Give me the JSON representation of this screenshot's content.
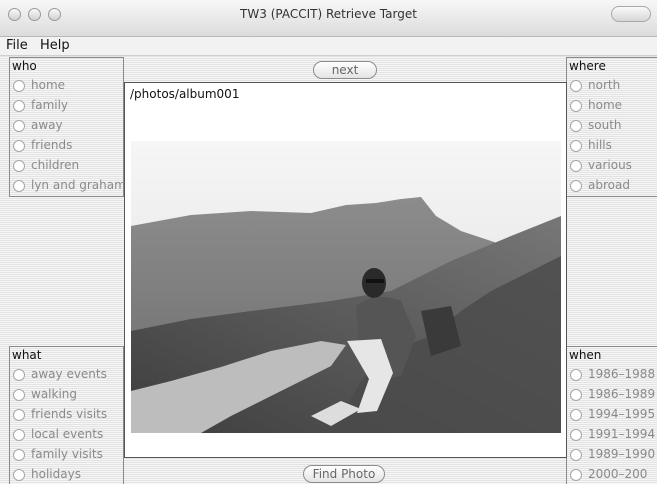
{
  "window": {
    "title": "TW3 (PACCIT) Retrieve Target"
  },
  "menu": {
    "file": "File",
    "help": "Help"
  },
  "who": {
    "label": "who",
    "options": [
      "home",
      "family",
      "away",
      "friends",
      "children",
      "lyn and graham"
    ]
  },
  "what": {
    "label": "what",
    "options": [
      "away events",
      "walking",
      "friends visits",
      "local events",
      "family visits",
      "holidays"
    ]
  },
  "where": {
    "label": "where",
    "options": [
      "north",
      "home",
      "south",
      "hills",
      "various",
      "abroad"
    ]
  },
  "when": {
    "label": "when",
    "options": [
      "1986–1988",
      "1986–1989",
      "1994–1995",
      "1991–1994",
      "1989–1990",
      "2000–200"
    ]
  },
  "center": {
    "next_label": "next",
    "path": "/photos/album001",
    "find_label": "Find Photo"
  },
  "icons": {
    "photo": "landscape-photo-icon"
  }
}
